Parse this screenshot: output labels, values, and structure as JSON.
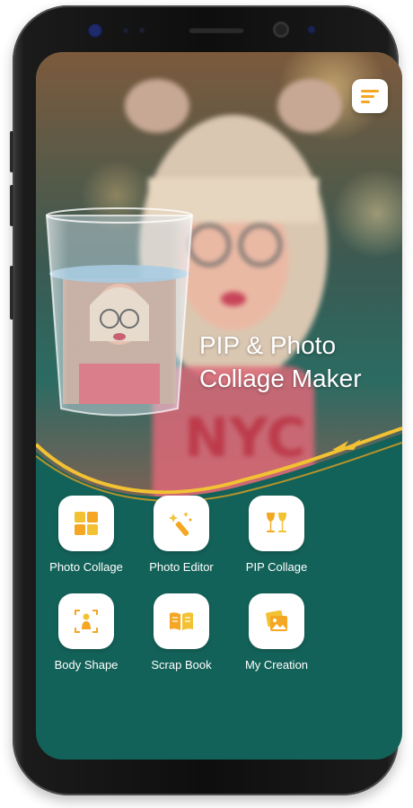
{
  "app": {
    "headline_line1": "PIP & Photo",
    "headline_line2": "Collage Maker"
  },
  "colors": {
    "brand_teal": "#136259",
    "accent_orange": "#f5a623",
    "accent_yellow": "#f2c233",
    "tile_bg": "#ffffff"
  },
  "menu_button": {
    "icon": "menu-lines-icon"
  },
  "features": [
    {
      "label": "Photo Collage",
      "icon": "grid-icon"
    },
    {
      "label": "Photo Editor",
      "icon": "magic-wand-icon"
    },
    {
      "label": "PIP Collage",
      "icon": "wine-glasses-icon"
    },
    {
      "label": "Body Shape",
      "icon": "body-scan-icon"
    },
    {
      "label": "Scrap Book",
      "icon": "open-book-icon"
    },
    {
      "label": "My Creation",
      "icon": "photo-stack-icon"
    }
  ]
}
